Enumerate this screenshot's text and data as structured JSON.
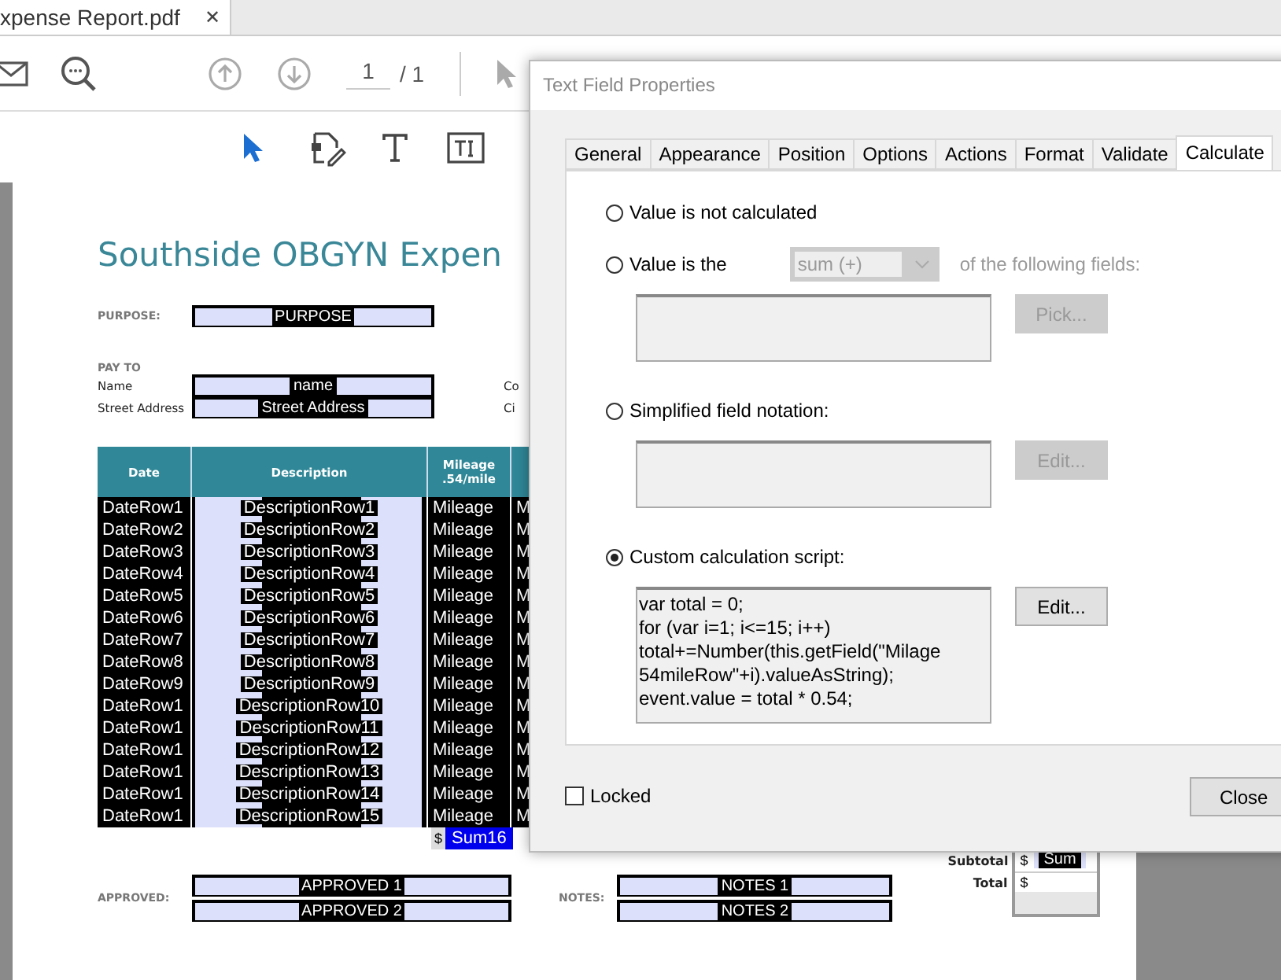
{
  "document_tab": {
    "title": "xpense Report.pdf",
    "close": "✕"
  },
  "toolbar": {
    "page_current": "1",
    "page_total": "/ 1"
  },
  "document": {
    "title": "Southside OBGYN Expen",
    "purpose": {
      "label": "PURPOSE:",
      "value": "PURPOSE"
    },
    "pay_to": {
      "label": "PAY TO",
      "fields": [
        {
          "label": "Name",
          "value": "name",
          "side_label": "Co"
        },
        {
          "label": "Street Address",
          "value": "Street Address",
          "side_label": "Ci"
        }
      ]
    },
    "table": {
      "columns": [
        "Date",
        "Description",
        "Mileage .54/mile"
      ],
      "rows": [
        {
          "date": "DateRow1",
          "description": "DescriptionRow1",
          "mileage": "Mileage",
          "column_4": "M"
        },
        {
          "date": "DateRow2",
          "description": "DescriptionRow2",
          "mileage": "Mileage",
          "column_4": "M"
        },
        {
          "date": "DateRow3",
          "description": "DescriptionRow3",
          "mileage": "Mileage",
          "column_4": "M"
        },
        {
          "date": "DateRow4",
          "description": "DescriptionRow4",
          "mileage": "Mileage",
          "column_4": "M"
        },
        {
          "date": "DateRow5",
          "description": "DescriptionRow5",
          "mileage": "Mileage",
          "column_4": "M"
        },
        {
          "date": "DateRow6",
          "description": "DescriptionRow6",
          "mileage": "Mileage",
          "column_4": "M"
        },
        {
          "date": "DateRow7",
          "description": "DescriptionRow7",
          "mileage": "Mileage",
          "column_4": "M"
        },
        {
          "date": "DateRow8",
          "description": "DescriptionRow8",
          "mileage": "Mileage",
          "column_4": "M"
        },
        {
          "date": "DateRow9",
          "description": "DescriptionRow9",
          "mileage": "Mileage",
          "column_4": "M"
        },
        {
          "date": "DateRow1",
          "description": "DescriptionRow10",
          "mileage": "Mileage",
          "column_4": "M"
        },
        {
          "date": "DateRow1",
          "description": "DescriptionRow11",
          "mileage": "Mileage",
          "column_4": "M"
        },
        {
          "date": "DateRow1",
          "description": "DescriptionRow12",
          "mileage": "Mileage",
          "column_4": "M"
        },
        {
          "date": "DateRow1",
          "description": "DescriptionRow13",
          "mileage": "Mileage",
          "column_4": "M"
        },
        {
          "date": "DateRow1",
          "description": "DescriptionRow14",
          "mileage": "Mileage",
          "column_4": "M"
        },
        {
          "date": "DateRow1",
          "description": "DescriptionRow15",
          "mileage": "Mileage",
          "column_4": "M"
        }
      ],
      "sum": {
        "currency": "$",
        "value": "Sum16"
      }
    },
    "approved": {
      "label": "APPROVED:",
      "fields": [
        "APPROVED 1",
        "APPROVED 2"
      ]
    },
    "notes": {
      "label": "NOTES:",
      "fields": [
        "NOTES 1",
        "NOTES 2"
      ]
    },
    "totals": [
      {
        "label": "Subtotal",
        "currency": "$",
        "value": "Sum"
      },
      {
        "label": "Total",
        "currency": "$"
      }
    ]
  },
  "dialog": {
    "title": "Text Field Properties",
    "tabs": [
      {
        "label": "General",
        "selected": false
      },
      {
        "label": "Appearance",
        "selected": false
      },
      {
        "label": "Position",
        "selected": false
      },
      {
        "label": "Options",
        "selected": false
      },
      {
        "label": "Actions",
        "selected": false
      },
      {
        "label": "Format",
        "selected": false
      },
      {
        "label": "Validate",
        "selected": false
      },
      {
        "label": "Calculate",
        "selected": true
      }
    ],
    "options": [
      {
        "kind": "plain",
        "label": "Value is not calculated",
        "selected": false
      },
      {
        "kind": "field",
        "label": "Value is the",
        "selected": false,
        "select": {
          "value": "sum (+)",
          "disabled": true
        },
        "suffix": "of the following fields:",
        "button": {
          "label": "Pick...",
          "disabled": true
        }
      },
      {
        "kind": "field",
        "label": "Simplified field notation:",
        "selected": false,
        "button": {
          "label": "Edit...",
          "disabled": true
        }
      },
      {
        "kind": "field",
        "label": "Custom calculation script:",
        "selected": true,
        "field": {
          "lines": [
            "var total = 0;",
            "for (var i=1; i<=15; i++)",
            "total+=Number(this.getField(\"Milage",
            "54mileRow\"+i).valueAsString);",
            "event.value = total * 0.54;"
          ]
        },
        "button": {
          "label": "Edit...",
          "disabled": false
        }
      }
    ],
    "locked": {
      "label": "Locked",
      "checked": false
    },
    "close": "Close"
  }
}
